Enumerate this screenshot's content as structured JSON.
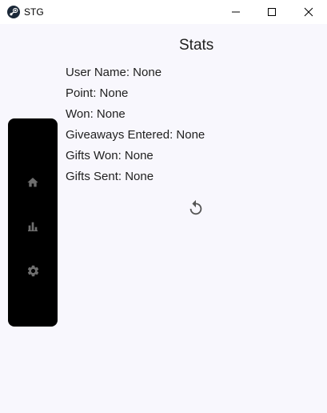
{
  "window": {
    "title": "STG"
  },
  "page": {
    "title": "Stats"
  },
  "stats": [
    {
      "label": "User Name: None"
    },
    {
      "label": "Point: None"
    },
    {
      "label": "Won: None"
    },
    {
      "label": "Giveaways Entered: None"
    },
    {
      "label": "Gifts Won: None"
    },
    {
      "label": "Gifts Sent: None"
    }
  ],
  "nav": {
    "items": [
      {
        "icon": "home-icon"
      },
      {
        "icon": "bar-chart-icon"
      },
      {
        "icon": "gear-icon"
      }
    ]
  },
  "actions": {
    "refresh_icon": "refresh-icon"
  },
  "colors": {
    "background": "#f8f7fd",
    "nav_rail": "#000000",
    "nav_icon": "#6e6e6e",
    "text": "#1f1f1f"
  }
}
